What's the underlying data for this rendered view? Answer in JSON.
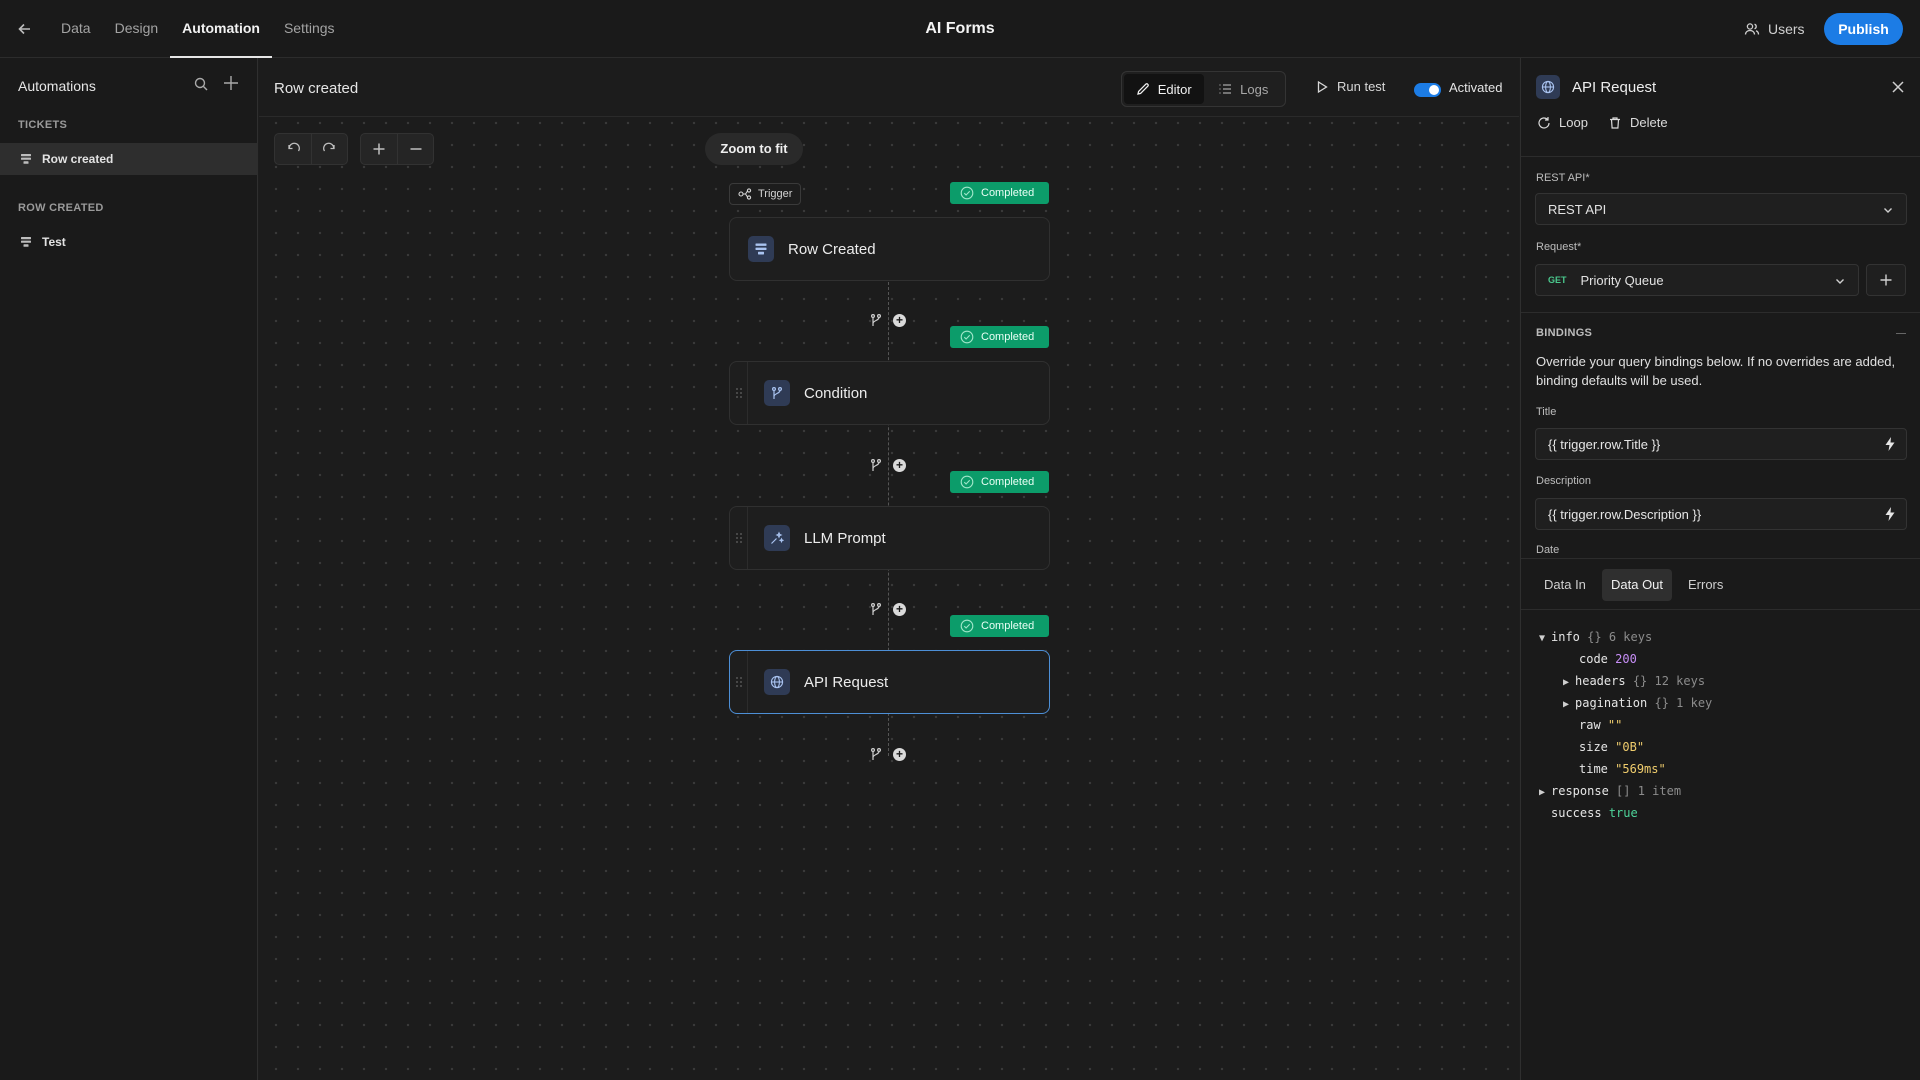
{
  "nav": {
    "tabs": [
      {
        "label": "Data"
      },
      {
        "label": "Design"
      },
      {
        "label": "Automation"
      },
      {
        "label": "Settings"
      }
    ],
    "app_title": "AI Forms",
    "users_label": "Users",
    "publish_label": "Publish"
  },
  "sidebar": {
    "title": "Automations",
    "sections": [
      {
        "heading": "TICKETS",
        "items": [
          {
            "label": "Row created",
            "active": true
          }
        ]
      },
      {
        "heading": "ROW CREATED",
        "items": [
          {
            "label": "Test",
            "active": false
          }
        ]
      }
    ]
  },
  "canvas": {
    "title": "Row created",
    "editor_label": "Editor",
    "logs_label": "Logs",
    "run_test_label": "Run test",
    "activated_label": "Activated",
    "activated": true,
    "zoom_fit_label": "Zoom to fit",
    "trigger_tag": "Trigger",
    "steps": [
      {
        "label": "Row Created",
        "status": "Completed",
        "icon": "table-row-icon"
      },
      {
        "label": "Condition",
        "status": "Completed",
        "icon": "branch-icon"
      },
      {
        "label": "LLM Prompt",
        "status": "Completed",
        "icon": "sparkle-line-icon"
      },
      {
        "label": "API Request",
        "status": "Completed",
        "icon": "globe-icon",
        "selected": true
      }
    ]
  },
  "panel": {
    "title": "API Request",
    "loop_label": "Loop",
    "delete_label": "Delete",
    "rest_api_label": "REST API*",
    "rest_api_value": "REST API",
    "request_label": "Request*",
    "request_method": "GET",
    "request_value": "Priority Queue",
    "bindings_heading": "BINDINGS",
    "bindings_desc": "Override your query bindings below. If no overrides are added, binding defaults will be used.",
    "fields": [
      {
        "label": "Title",
        "value": "{{ trigger.row.Title }}"
      },
      {
        "label": "Description",
        "value": "{{ trigger.row.Description }}"
      },
      {
        "label": "Date",
        "value": ""
      }
    ],
    "data_tabs": [
      {
        "label": "Data In"
      },
      {
        "label": "Data Out"
      },
      {
        "label": "Errors"
      }
    ],
    "json": {
      "info_key": "info",
      "info_meta": "{} 6 keys",
      "code_key": "code",
      "code_val": "200",
      "headers_key": "headers",
      "headers_meta": "{} 12 keys",
      "pagination_key": "pagination",
      "pagination_meta": "{} 1 key",
      "raw_key": "raw",
      "raw_val": "\"\"",
      "size_key": "size",
      "size_val": "\"0B\"",
      "time_key": "time",
      "time_val": "\"569ms\"",
      "response_key": "response",
      "response_meta": "[] 1 item",
      "success_key": "success",
      "success_val": "true"
    }
  },
  "colors": {
    "accent": "#1c7ce5",
    "completed": "#0c9c6a",
    "background": "#1c1c1c"
  }
}
